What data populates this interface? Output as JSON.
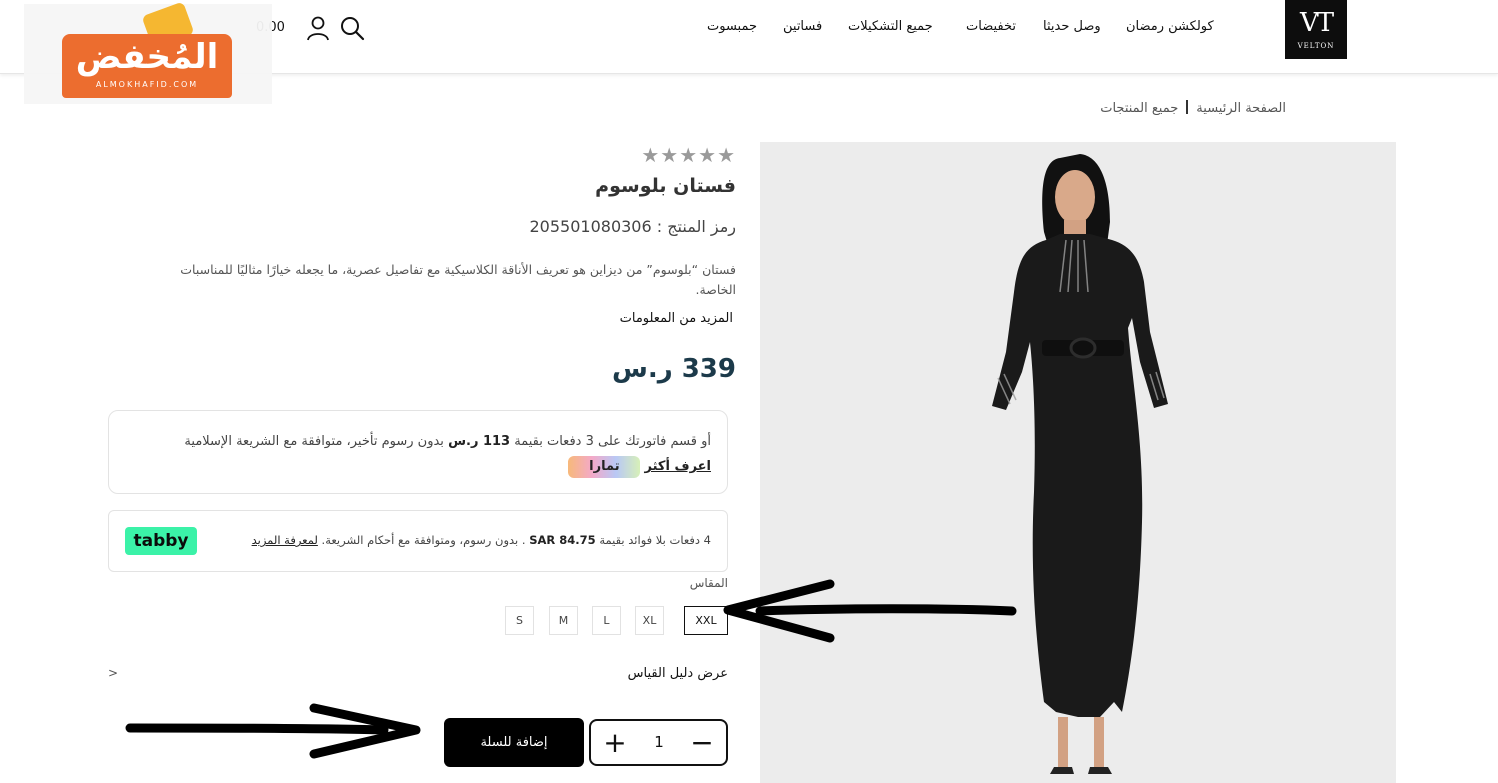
{
  "header": {
    "brand_mark": "VT",
    "brand_name": "VELTON",
    "nav": [
      "كولكشن رمضان",
      "وصل حديثا",
      "تخفيضات",
      "جميع التشكيلات",
      "فساتين",
      "جمبسوت"
    ],
    "cart_amount": "0.00",
    "icons": {
      "search": "search-icon",
      "account": "user-icon"
    }
  },
  "watermark": {
    "arabic": "المُخفض",
    "latin": "ALMOKHAFID.COM"
  },
  "breadcrumb": {
    "home": "الصفحة الرئيسية",
    "current": "جميع المنتجات"
  },
  "product": {
    "rating_stars": 5,
    "stars_text": "★★★★★",
    "title": "فستان بلوسوم",
    "sku_label": "رمز المنتج :",
    "sku_value": "205501080306",
    "description": "فستان “بلوسوم” من ديزاين هو تعريف الأناقة الكلاسيكية مع تفاصيل عصرية، ما يجعله خيارًا مثاليًا للمناسبات الخاصة.",
    "more_info": "المزيد من المعلومات",
    "price": "339 ر.س"
  },
  "tamara": {
    "text_before": "أو قسم فاتورتك على 3 دفعات بقيمة",
    "amount": "113 ر.س",
    "text_after": "بدون رسوم تأخير، متوافقة مع الشريعة الإسلامية",
    "learn_more": "اعرف أكثر",
    "logo": "تمارا"
  },
  "tabby": {
    "text_before": "4 دفعات بلا فوائد بقيمة",
    "amount": "SAR 84.75",
    "text_after": ". بدون رسوم، ومتوافقة مع أحكام الشريعة.",
    "learn_more": "لمعرفة المزيد",
    "logo": "tabby"
  },
  "size": {
    "label": "المقاس",
    "options": [
      "XXL",
      "XL",
      "L",
      "M",
      "S"
    ],
    "selected": "XXL"
  },
  "size_guide": {
    "label": "عرض دليل القياس",
    "chevron": ">"
  },
  "cart": {
    "qty": "1",
    "plus": "+",
    "minus": "−",
    "add_label": "إضافة للسلة"
  },
  "colors": {
    "dark": "#000000",
    "price": "#1c3a4a",
    "tabby": "#3bf2a8",
    "watermark": "#ec6d2f"
  }
}
